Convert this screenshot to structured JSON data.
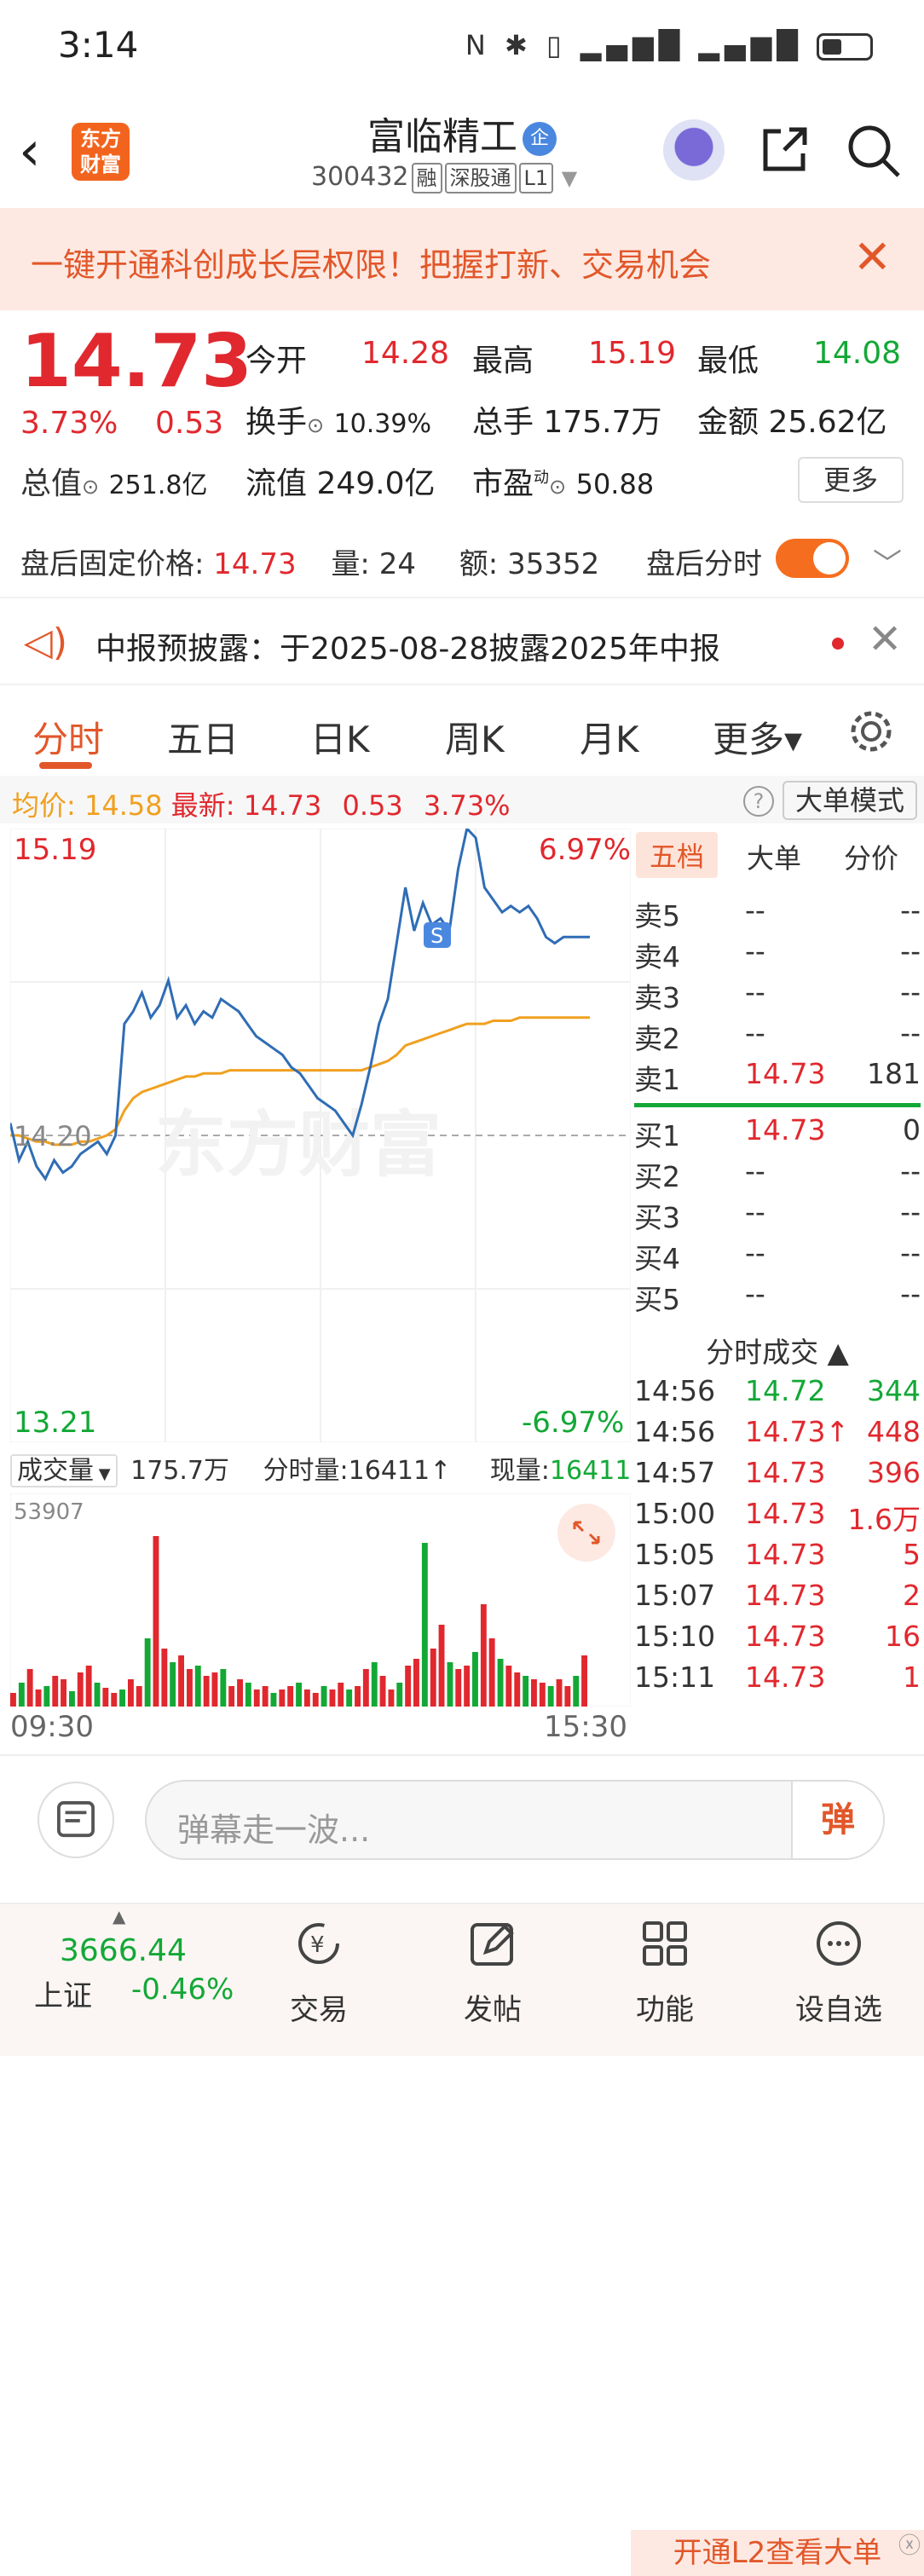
{
  "status": {
    "time": "3:14",
    "icons": "N ✱ ▯ ▂▄▆█ ▂▄▆█"
  },
  "header": {
    "logo": "东方财富",
    "name": "富临精工",
    "badge": "企",
    "code": "300432",
    "tags": [
      "融",
      "深股通",
      "L1"
    ]
  },
  "banner": {
    "text": "一键开通科创成长层权限！把握打新、交易机会",
    "close": "✕"
  },
  "quote": {
    "price": "14.73",
    "pct": "3.73%",
    "chg": "0.53",
    "open_l": "今开",
    "open": "14.28",
    "high_l": "最高",
    "high": "15.19",
    "low_l": "最低",
    "low": "14.08",
    "turn_l": "换手",
    "turn": "10.39%",
    "vol_l": "总手",
    "vol": "175.7万",
    "amt_l": "金额",
    "amt": "25.62亿",
    "mcap_l": "总值",
    "mcap": "251.8亿",
    "fcap_l": "流值",
    "fcap": "249.0亿",
    "pe_l": "市盈",
    "pe_sup": "动",
    "pe": "50.88",
    "more": "更多"
  },
  "after": {
    "label": "盘后固定价格:",
    "price": "14.73",
    "vol_l": "量:",
    "vol": "24",
    "amt_l": "额:",
    "amt": "35352",
    "tshare": "盘后分时"
  },
  "notice": {
    "text": "中报预披露：于2025-08-28披露2025年中报"
  },
  "tabs": [
    "分时",
    "五日",
    "日K",
    "周K",
    "月K",
    "更多▾"
  ],
  "avg": {
    "l": "均价:",
    "v": "14.58",
    "nl": "最新:",
    "nv": "14.73",
    "chg": "0.53",
    "pct": "3.73%",
    "mode": "大单模式",
    "help": "?"
  },
  "chart_data": {
    "type": "line",
    "ylim": [
      13.21,
      15.19
    ],
    "pct_top": "6.97%",
    "pct_bottom": "-6.97%",
    "top": "15.19",
    "bottom": "13.21",
    "mid": "14.20",
    "x_start": "09:30",
    "x_end": "15:30",
    "watermark": "东方财富",
    "marker": "S",
    "series": [
      {
        "values": [
          14.24,
          14.12,
          14.18,
          14.1,
          14.06,
          14.12,
          14.08,
          14.1,
          14.14,
          14.16,
          14.18,
          14.14,
          14.2,
          14.56,
          14.6,
          14.66,
          14.58,
          14.62,
          14.7,
          14.58,
          14.62,
          14.56,
          14.6,
          14.58,
          14.64,
          14.62,
          14.6,
          14.56,
          14.52,
          14.5,
          14.48,
          14.46,
          14.42,
          14.4,
          14.36,
          14.32,
          14.3,
          14.28,
          14.24,
          14.2,
          14.3,
          14.42,
          14.56,
          14.64,
          14.82,
          15.0,
          14.86,
          14.95,
          14.88,
          14.9,
          14.86,
          15.06,
          15.19,
          15.16,
          15.0,
          14.96,
          14.92,
          14.94,
          14.92,
          14.94,
          14.9,
          14.84,
          14.82,
          14.84,
          14.84,
          14.84,
          14.84
        ]
      },
      {
        "values": [
          14.2,
          14.2,
          14.19,
          14.18,
          14.18,
          14.17,
          14.17,
          14.17,
          14.18,
          14.18,
          14.19,
          14.2,
          14.22,
          14.28,
          14.32,
          14.34,
          14.35,
          14.36,
          14.37,
          14.38,
          14.39,
          14.39,
          14.4,
          14.4,
          14.4,
          14.41,
          14.41,
          14.41,
          14.41,
          14.41,
          14.41,
          14.41,
          14.41,
          14.41,
          14.41,
          14.41,
          14.41,
          14.41,
          14.41,
          14.41,
          14.41,
          14.42,
          14.43,
          14.44,
          14.46,
          14.49,
          14.5,
          14.51,
          14.52,
          14.53,
          14.54,
          14.55,
          14.56,
          14.56,
          14.56,
          14.57,
          14.57,
          14.57,
          14.58,
          14.58,
          14.58,
          14.58,
          14.58,
          14.58,
          14.58,
          14.58,
          14.58
        ]
      }
    ],
    "volume": {
      "label": "成交量",
      "total": "175.7万",
      "fs_l": "分时量:",
      "fs": "16411↑",
      "now_l": "现量:",
      "now": "16411",
      "max": "53907",
      "values": [
        8,
        14,
        22,
        10,
        12,
        18,
        16,
        9,
        20,
        24,
        14,
        11,
        8,
        10,
        16,
        12,
        40,
        100,
        34,
        26,
        30,
        22,
        24,
        18,
        20,
        22,
        12,
        16,
        14,
        10,
        12,
        8,
        10,
        12,
        14,
        10,
        8,
        12,
        10,
        14,
        10,
        12,
        22,
        26,
        18,
        10,
        14,
        24,
        28,
        96,
        34,
        48,
        26,
        22,
        24,
        32,
        60,
        40,
        28,
        24,
        20,
        18,
        16,
        14,
        12,
        16,
        12,
        18,
        30
      ]
    }
  },
  "orderbook": {
    "tabs": [
      "五档",
      "大单",
      "分价"
    ],
    "asks": [
      [
        "卖5",
        "--",
        "--"
      ],
      [
        "卖4",
        "--",
        "--"
      ],
      [
        "卖3",
        "--",
        "--"
      ],
      [
        "卖2",
        "--",
        "--"
      ],
      [
        "卖1",
        "14.73",
        "181"
      ]
    ],
    "bids": [
      [
        "买1",
        "14.73",
        "0"
      ],
      [
        "买2",
        "--",
        "--"
      ],
      [
        "买3",
        "--",
        "--"
      ],
      [
        "买4",
        "--",
        "--"
      ],
      [
        "买5",
        "--",
        "--"
      ]
    ],
    "trades_title": "分时成交 ▲",
    "trades": [
      [
        "14:56",
        "14.72",
        "344"
      ],
      [
        "14:56",
        "14.73↑",
        "448"
      ],
      [
        "14:57",
        "14.73",
        "396"
      ],
      [
        "15:00",
        "14.73",
        "1.6万"
      ],
      [
        "15:05",
        "14.73",
        "5"
      ],
      [
        "15:07",
        "14.73",
        "2"
      ],
      [
        "15:10",
        "14.73",
        "16"
      ],
      [
        "15:11",
        "14.73",
        "1"
      ]
    ],
    "l2": "开通L2查看大单"
  },
  "comment": {
    "placeholder": "弹幕走一波...",
    "send": "弹"
  },
  "bottom": {
    "idx": "3666.44",
    "idx_name": "上证",
    "idx_chg": "-0.46%",
    "nav": [
      "交易",
      "发帖",
      "功能",
      "设自选"
    ]
  },
  "colors": {
    "red": "#e0282e",
    "green": "#13a836",
    "orange": "#e2572a",
    "avg": "#f0a020",
    "line": "#2f6db5"
  }
}
